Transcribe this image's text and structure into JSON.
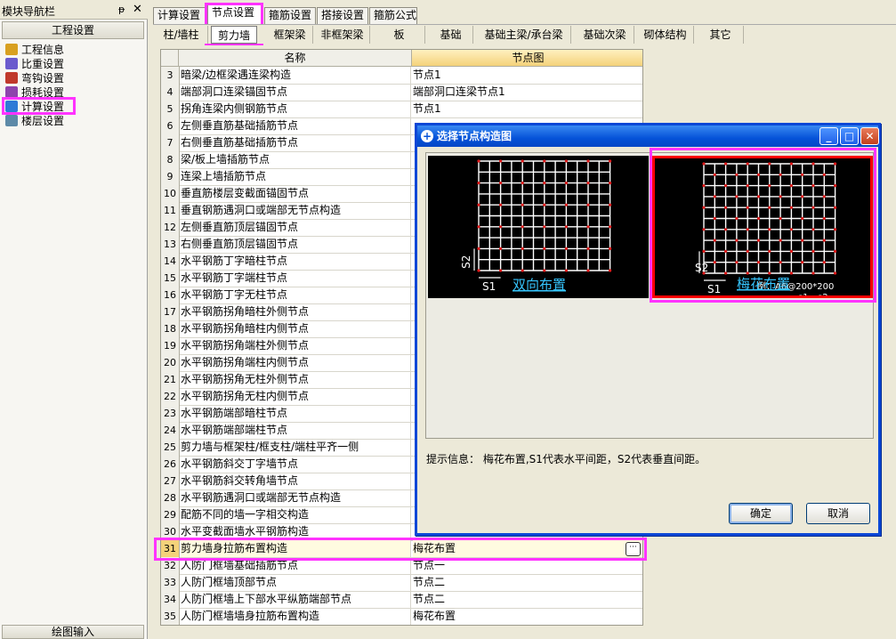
{
  "nav": {
    "title": "模块导航栏",
    "pin": "ᵽ",
    "close": "✕",
    "group": "工程设置",
    "items": [
      {
        "label": "工程信息",
        "icon": "project-info-icon",
        "color": "#d8a020"
      },
      {
        "label": "比重设置",
        "icon": "density-icon",
        "color": "#6a5acd"
      },
      {
        "label": "弯钩设置",
        "icon": "hook-icon",
        "color": "#c0392b"
      },
      {
        "label": "损耗设置",
        "icon": "loss-icon",
        "color": "#8e44ad"
      },
      {
        "label": "计算设置",
        "icon": "calc-settings-icon",
        "color": "#2e7bd6"
      },
      {
        "label": "楼层设置",
        "icon": "floor-icon",
        "color": "#5d8aa8"
      }
    ],
    "bottom": "绘图输入"
  },
  "tabs": [
    "计算设置",
    "节点设置",
    "箍筋设置",
    "搭接设置",
    "箍筋公式"
  ],
  "subtabs": [
    "柱/墙柱",
    "剪力墙",
    "框架梁",
    "非框架梁",
    "板",
    "基础",
    "基础主梁/承台梁",
    "基础次梁",
    "砌体结构",
    "其它"
  ],
  "grid": {
    "headers": {
      "name": "名称",
      "node": "节点图"
    },
    "rows": [
      {
        "num": "3",
        "name": "暗梁/边框梁遇连梁构造",
        "node": "节点1"
      },
      {
        "num": "4",
        "name": "端部洞口连梁锚固节点",
        "node": "端部洞口连梁节点1"
      },
      {
        "num": "5",
        "name": "拐角连梁内侧钢筋节点",
        "node": "节点1"
      },
      {
        "num": "6",
        "name": "左侧垂直筋基础插筋节点",
        "node": ""
      },
      {
        "num": "7",
        "name": "右侧垂直筋基础插筋节点",
        "node": ""
      },
      {
        "num": "8",
        "name": "梁/板上墙插筋节点",
        "node": ""
      },
      {
        "num": "9",
        "name": "连梁上墙插筋节点",
        "node": ""
      },
      {
        "num": "10",
        "name": "垂直筋楼层变截面锚固节点",
        "node": ""
      },
      {
        "num": "11",
        "name": "垂直钢筋遇洞口或端部无节点构造",
        "node": ""
      },
      {
        "num": "12",
        "name": "左侧垂直筋顶层锚固节点",
        "node": ""
      },
      {
        "num": "13",
        "name": "右侧垂直筋顶层锚固节点",
        "node": ""
      },
      {
        "num": "14",
        "name": "水平钢筋丁字暗柱节点",
        "node": ""
      },
      {
        "num": "15",
        "name": "水平钢筋丁字端柱节点",
        "node": ""
      },
      {
        "num": "16",
        "name": "水平钢筋丁字无柱节点",
        "node": ""
      },
      {
        "num": "17",
        "name": "水平钢筋拐角暗柱外侧节点",
        "node": ""
      },
      {
        "num": "18",
        "name": "水平钢筋拐角暗柱内侧节点",
        "node": ""
      },
      {
        "num": "19",
        "name": "水平钢筋拐角端柱外侧节点",
        "node": ""
      },
      {
        "num": "20",
        "name": "水平钢筋拐角端柱内侧节点",
        "node": ""
      },
      {
        "num": "21",
        "name": "水平钢筋拐角无柱外侧节点",
        "node": ""
      },
      {
        "num": "22",
        "name": "水平钢筋拐角无柱内侧节点",
        "node": ""
      },
      {
        "num": "23",
        "name": "水平钢筋端部暗柱节点",
        "node": ""
      },
      {
        "num": "24",
        "name": "水平钢筋端部端柱节点",
        "node": ""
      },
      {
        "num": "25",
        "name": "剪力墙与框架柱/框支柱/端柱平齐一侧",
        "node": ""
      },
      {
        "num": "26",
        "name": "水平钢筋斜交丁字墙节点",
        "node": ""
      },
      {
        "num": "27",
        "name": "水平钢筋斜交转角墙节点",
        "node": ""
      },
      {
        "num": "28",
        "name": "水平钢筋遇洞口或端部无节点构造",
        "node": ""
      },
      {
        "num": "29",
        "name": "配筋不同的墙一字相交构造",
        "node": ""
      },
      {
        "num": "30",
        "name": "水平变截面墙水平钢筋构造",
        "node": ""
      },
      {
        "num": "31",
        "name": "剪力墙身拉筋布置构造",
        "node": "梅花布置"
      },
      {
        "num": "32",
        "name": "人防门框墙基础插筋节点",
        "node": "节点一"
      },
      {
        "num": "33",
        "name": "人防门框墙顶部节点",
        "node": "节点二"
      },
      {
        "num": "34",
        "name": "人防门框墙上下部水平纵筋端部节点",
        "node": "节点二"
      },
      {
        "num": "35",
        "name": "人防门框墙墙身拉筋布置构造",
        "node": "梅花布置"
      }
    ],
    "more_glyph": "···"
  },
  "dialog": {
    "title": "选择节点构造图",
    "title_icon": "+",
    "minimize": "_",
    "maximize": "□",
    "close": "✕",
    "options": [
      {
        "caption": "双向布置",
        "s1": "S1",
        "s2": "S2",
        "example": "",
        "ex_s1": "",
        "ex_s2": ""
      },
      {
        "caption": "梅花布置",
        "s1": "S1",
        "s2": "S2",
        "example": "例：A6@200*200",
        "ex_s1": "s1",
        "ex_s2": "s2"
      }
    ],
    "hint": "提示信息： 梅花布置,S1代表水平间距，S2代表垂直间距。",
    "ok": "确定",
    "cancel": "取消"
  },
  "colors": {
    "highlight": "#ff33ff",
    "selected_border": "#ff0000",
    "caption": "#36c6ff",
    "grid_line": "#ffffff",
    "dot": "#e01818"
  }
}
